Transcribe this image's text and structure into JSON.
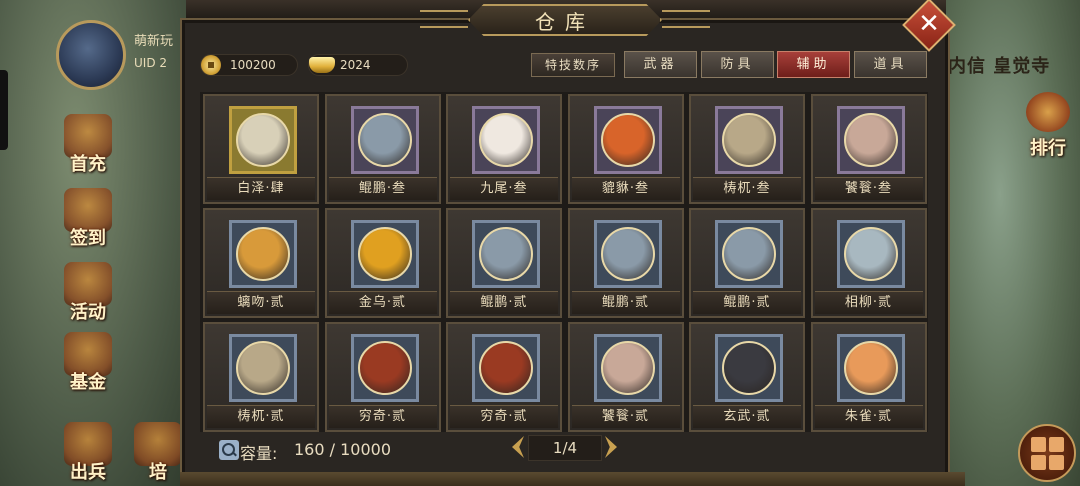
{
  "background": {
    "player_name": "萌新玩",
    "player_uid": "UID 2",
    "right_text": "内信 皇觉寺",
    "side_buttons": [
      "首充",
      "签到",
      "活动",
      "基金",
      "出兵",
      "培"
    ],
    "rank_button": "排行"
  },
  "panel": {
    "title": "仓库",
    "close_label": "✕"
  },
  "currencies": [
    {
      "icon": "copper-coin-icon",
      "value": "100200"
    },
    {
      "icon": "gold-ingot-icon",
      "value": "2024"
    }
  ],
  "sort_button": "特技数序",
  "tabs": [
    {
      "label": "武器",
      "active": false
    },
    {
      "label": "防具",
      "active": false
    },
    {
      "label": "辅助",
      "active": true
    },
    {
      "label": "道具",
      "active": false
    }
  ],
  "items": [
    {
      "name": "白泽·肆",
      "rarity": "gold",
      "color": "#d8d0b8"
    },
    {
      "name": "鲲鹏·叁",
      "rarity": "purple",
      "color": "#8a9aa8"
    },
    {
      "name": "九尾·叁",
      "rarity": "purple",
      "color": "#efe8e0"
    },
    {
      "name": "貔貅·叁",
      "rarity": "purple",
      "color": "#d8642a"
    },
    {
      "name": "梼杌·叁",
      "rarity": "purple",
      "color": "#b8a888"
    },
    {
      "name": "饕餮·叁",
      "rarity": "purple",
      "color": "#c8a898"
    },
    {
      "name": "螭吻·贰",
      "rarity": "blue",
      "color": "#d89a3a"
    },
    {
      "name": "金乌·贰",
      "rarity": "blue",
      "color": "#e0a020"
    },
    {
      "name": "鲲鹏·贰",
      "rarity": "blue",
      "color": "#8a9aa8"
    },
    {
      "name": "鲲鹏·贰",
      "rarity": "blue",
      "color": "#8a9aa8"
    },
    {
      "name": "鲲鹏·贰",
      "rarity": "blue",
      "color": "#8a9aa8"
    },
    {
      "name": "相柳·贰",
      "rarity": "blue",
      "color": "#a8b8c0"
    },
    {
      "name": "梼杌·贰",
      "rarity": "blue",
      "color": "#b8a888"
    },
    {
      "name": "穷奇·贰",
      "rarity": "blue",
      "color": "#9a3a22"
    },
    {
      "name": "穷奇·贰",
      "rarity": "blue",
      "color": "#9a3a22"
    },
    {
      "name": "饕餮·贰",
      "rarity": "blue",
      "color": "#c8a898"
    },
    {
      "name": "玄武·贰",
      "rarity": "blue",
      "color": "#3a3a40"
    },
    {
      "name": "朱雀·贰",
      "rarity": "blue",
      "color": "#e89a5a"
    }
  ],
  "capacity": {
    "label": "容量:",
    "value": "160 / 10000"
  },
  "pager": {
    "text": "1/4"
  }
}
